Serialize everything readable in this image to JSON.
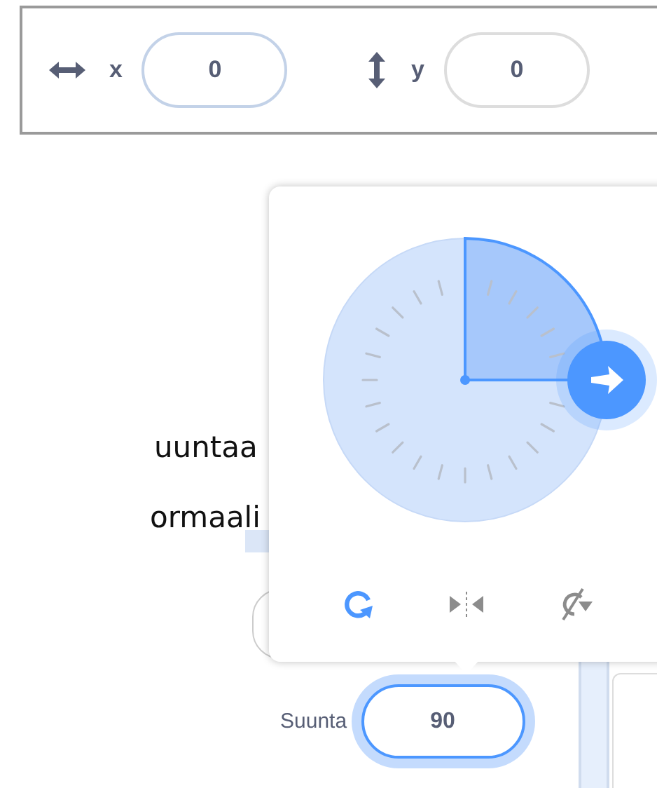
{
  "position": {
    "fields": [
      {
        "kind": "horizontal",
        "label": "x",
        "value": "0",
        "highlighted": true
      },
      {
        "kind": "vertical",
        "label": "y",
        "value": "0",
        "highlighted": false
      }
    ]
  },
  "background_text": [
    "uuntaa",
    "ormaali"
  ],
  "direction_popup": {
    "rotation_styles": [
      {
        "kind": "all-around",
        "selected": true
      },
      {
        "kind": "left-right",
        "selected": false
      },
      {
        "kind": "dont-rotate",
        "selected": false
      }
    ]
  },
  "direction_field": {
    "label": "Suunta",
    "value": "90",
    "focused": true
  }
}
